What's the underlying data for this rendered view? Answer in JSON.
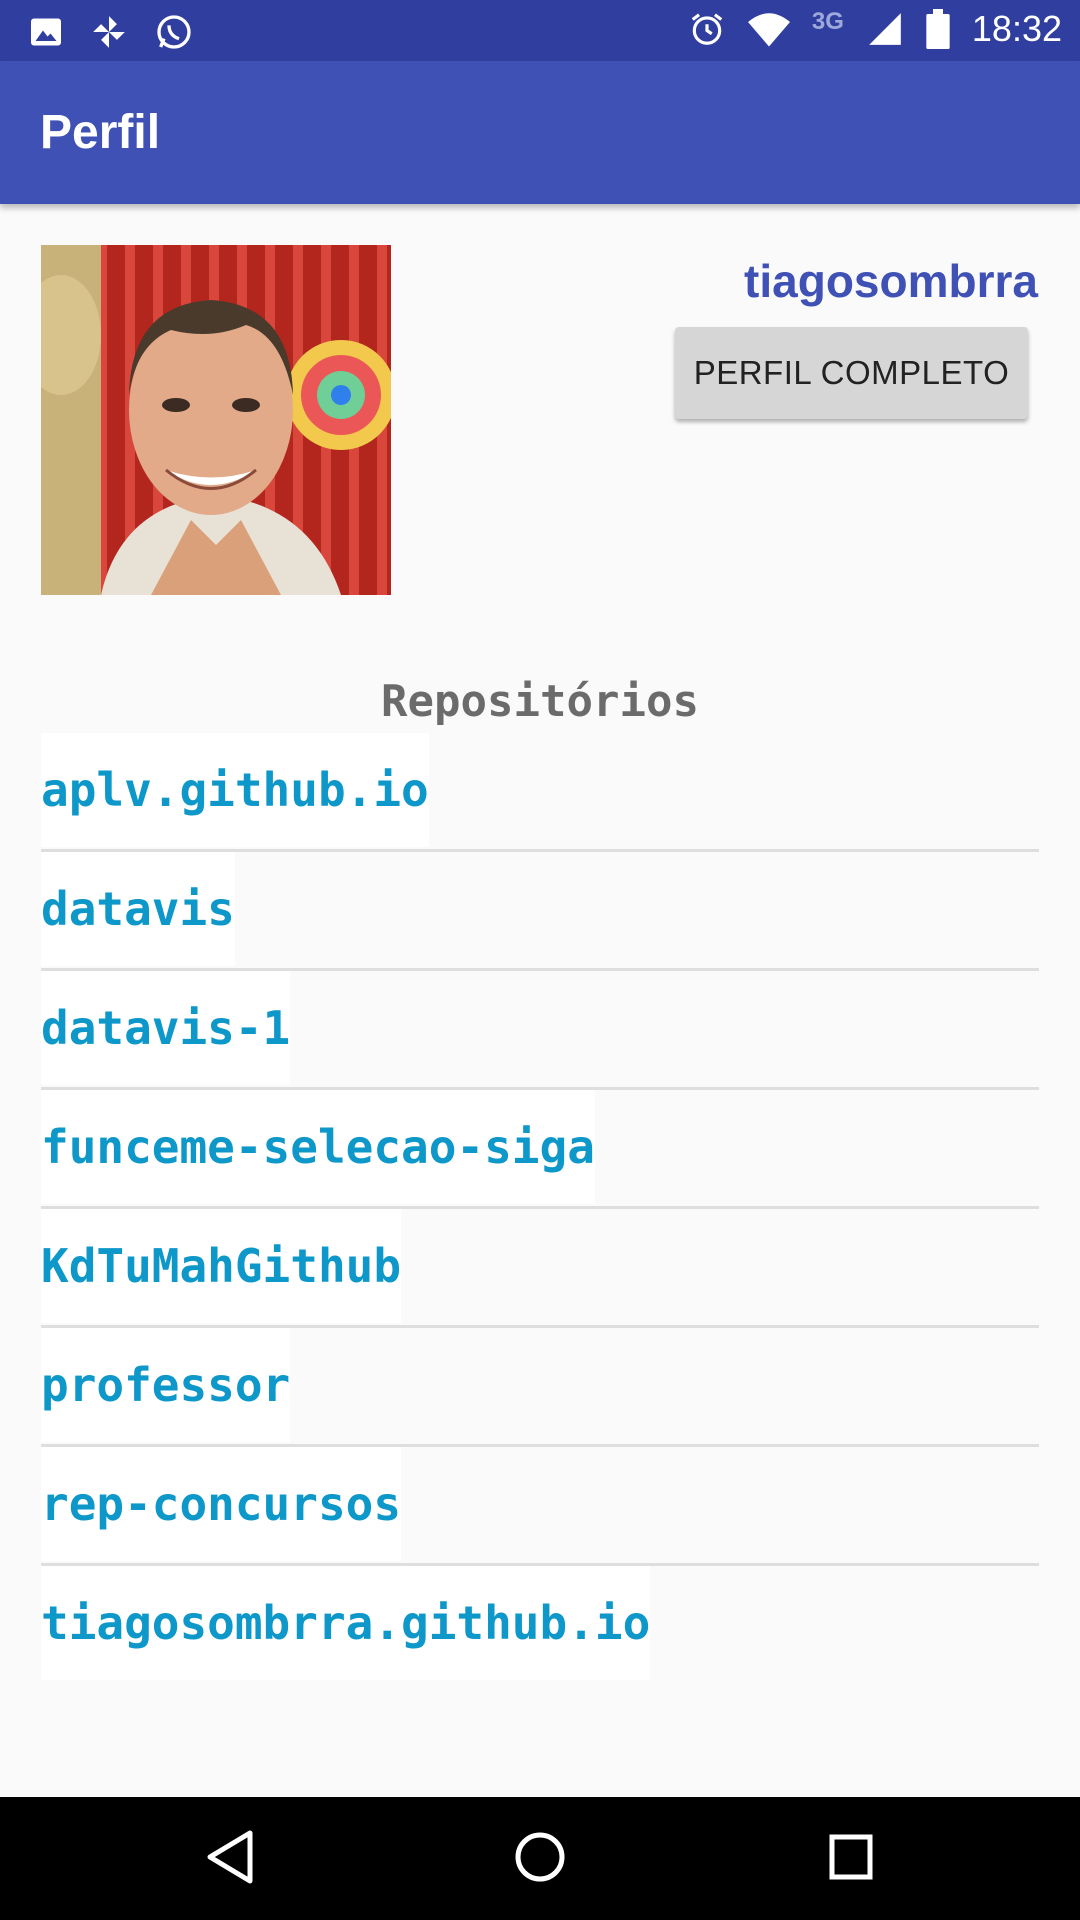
{
  "status_bar": {
    "time": "18:32",
    "network": "3G",
    "left_icons": [
      "image-icon",
      "pinwheel-icon",
      "whatsapp-icon"
    ],
    "right_icons": [
      "alarm-icon",
      "wifi-icon",
      "signal-icon",
      "battery-icon"
    ],
    "background": "#303f9f"
  },
  "app_bar": {
    "title": "Perfil",
    "background": "#3f51b5"
  },
  "profile": {
    "username": "tiagosombrra",
    "full_profile_button": "PERFIL COMPLETO"
  },
  "repositories": {
    "title": "Repositórios",
    "items": [
      "aplv.github.io",
      "datavis",
      "datavis-1",
      "funceme-selecao-siga",
      "KdTuMahGithub",
      "professor",
      "rep-concursos",
      "tiagosombrra.github.io"
    ],
    "link_color": "#0e97c9"
  },
  "nav_bar": {
    "buttons": [
      "back-icon",
      "home-icon",
      "recents-icon"
    ]
  }
}
